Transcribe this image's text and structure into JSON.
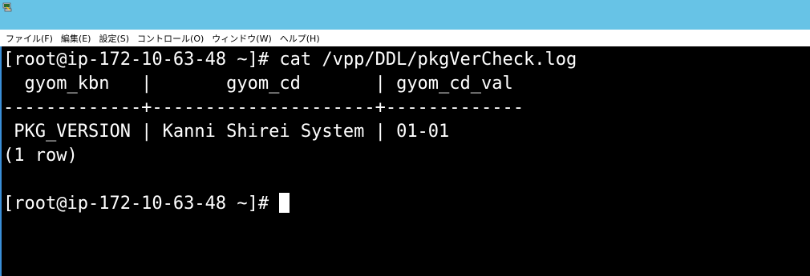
{
  "window": {
    "icon": "putty-terminal-icon"
  },
  "menu": {
    "items": [
      "ファイル(F)",
      "編集(E)",
      "設定(S)",
      "コントロール(O)",
      "ウィンドウ(W)",
      "ヘルプ(H)"
    ]
  },
  "terminal": {
    "lines": [
      "[root@ip-172-10-63-48 ~]# cat /vpp/DDL/pkgVerCheck.log",
      "  gyom_kbn   |       gyom_cd       | gyom_cd_val",
      "-------------+---------------------+-------------",
      " PKG_VERSION | Kanni Shirei System | 01-01",
      "(1 row)",
      ""
    ],
    "prompt": "[root@ip-172-10-63-48 ~]# "
  },
  "colors": {
    "titlebar": "#67c3e6",
    "terminal_bg": "#000000",
    "terminal_fg": "#ffffff"
  }
}
